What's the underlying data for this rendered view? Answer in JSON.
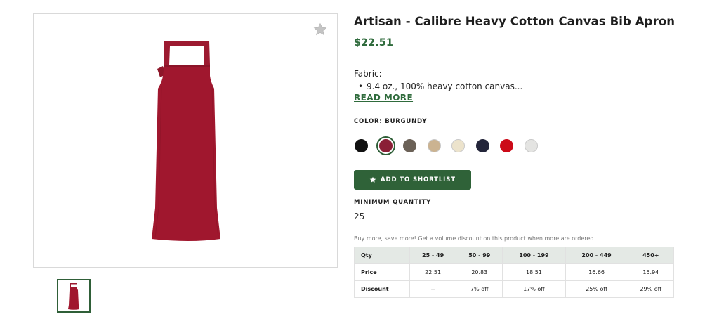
{
  "product": {
    "title": "Artisan - Calibre Heavy Cotton Canvas Bib Apron",
    "price": "$22.51",
    "fabric_label": "Fabric:",
    "fabric_bullet": "9.4 oz., 100% heavy cotton canvas...",
    "read_more": "READ MORE"
  },
  "color": {
    "label": "COLOR: BURGUNDY",
    "selected": "burgundy",
    "swatches": [
      {
        "name": "black",
        "hex": "#111111"
      },
      {
        "name": "burgundy",
        "hex": "#8a1f36"
      },
      {
        "name": "brown-grey",
        "hex": "#6b6157"
      },
      {
        "name": "khaki",
        "hex": "#cbb391"
      },
      {
        "name": "natural",
        "hex": "#ece3cc"
      },
      {
        "name": "navy",
        "hex": "#23253a"
      },
      {
        "name": "red",
        "hex": "#cc0a18"
      },
      {
        "name": "light-grey",
        "hex": "#e4e4e2"
      }
    ]
  },
  "actions": {
    "shortlist_label": "ADD TO SHORTLIST",
    "shortlist_icon": "star-icon",
    "favorite_icon": "star-icon"
  },
  "quantity": {
    "label": "MINIMUM QUANTITY",
    "value": "25"
  },
  "volume": {
    "note": "Buy more, save more! Get a volume discount on this product when more are ordered.",
    "headers": [
      "Qty",
      "25 - 49",
      "50 - 99",
      "100 - 199",
      "200 - 449",
      "450+"
    ],
    "rows": [
      {
        "label": "Price",
        "cells": [
          "22.51",
          "20.83",
          "18.51",
          "16.66",
          "15.94"
        ]
      },
      {
        "label": "Discount",
        "cells": [
          "--",
          "7% off",
          "17% off",
          "25% off",
          "29% off"
        ]
      }
    ]
  },
  "colors": {
    "accent_green": "#2f6b3c",
    "button_green": "#2f6238",
    "apron": "#a0172e"
  }
}
